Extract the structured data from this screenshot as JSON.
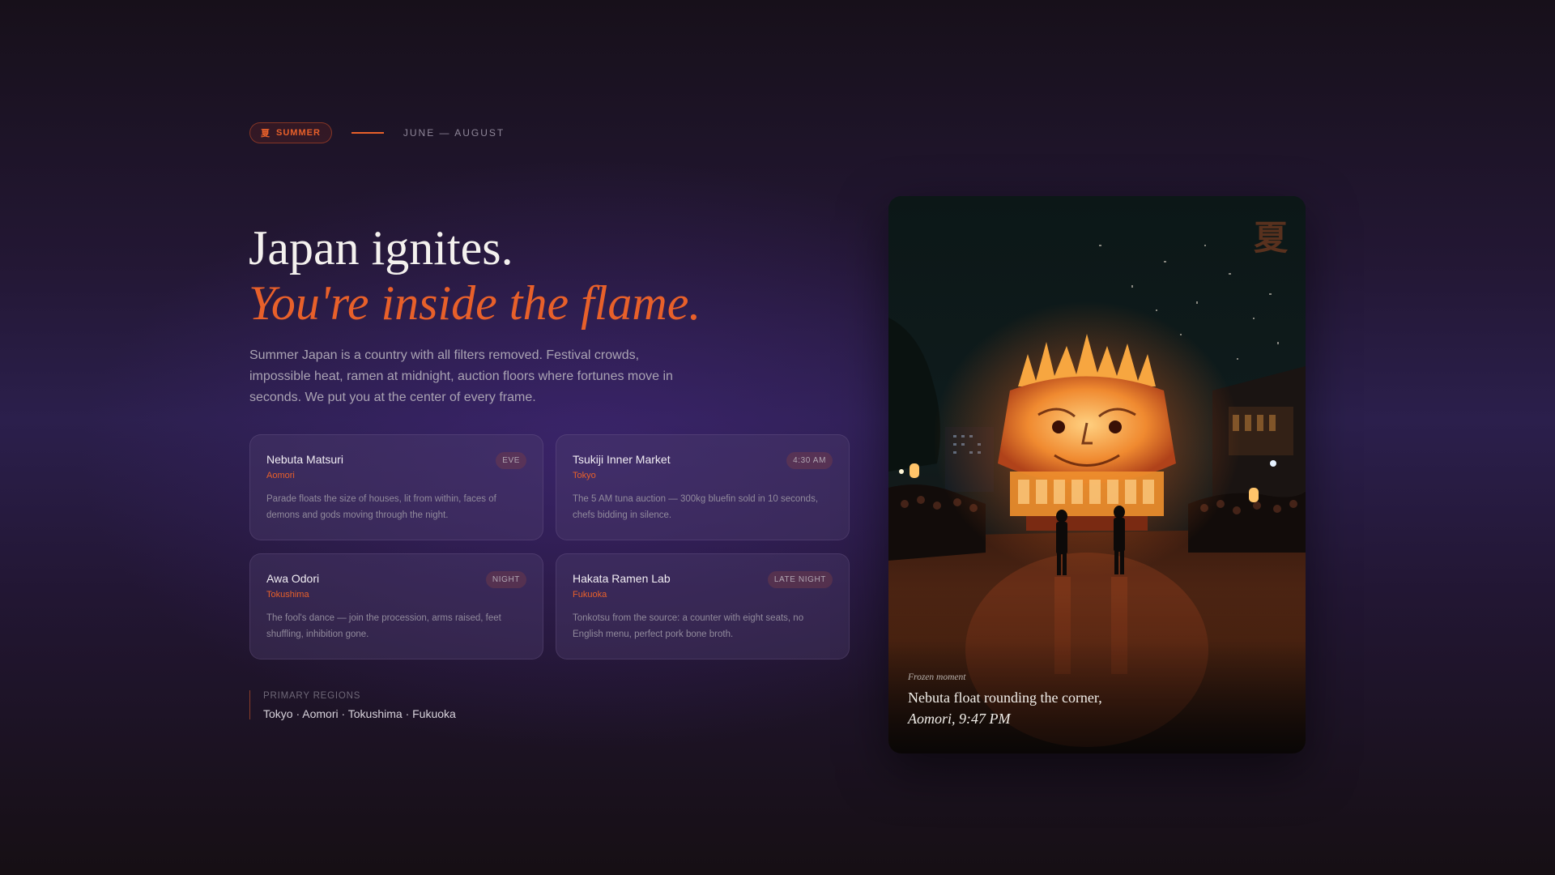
{
  "header": {
    "season_icon": "夏",
    "season_label": "SUMMER",
    "season_range": "JUNE — AUGUST"
  },
  "hero": {
    "title_line1": "Japan ignites.",
    "title_line2": "You're inside the flame.",
    "intro": "Summer Japan is a country with all filters removed. Festival crowds, impossible heat, ramen at midnight, auction floors where fortunes move in seconds. We put you at the center of every frame."
  },
  "cards": [
    {
      "title": "Nebuta Matsuri",
      "location": "Aomori",
      "tag": "EVE",
      "description": "Parade floats the size of houses, lit from within, faces of demons and gods moving through the night."
    },
    {
      "title": "Tsukiji Inner Market",
      "location": "Tokyo",
      "tag": "4:30 AM",
      "description": "The 5 AM tuna auction — 300kg bluefin sold in 10 seconds, chefs bidding in silence."
    },
    {
      "title": "Awa Odori",
      "location": "Tokushima",
      "tag": "NIGHT",
      "description": "The fool's dance — join the procession, arms raised, feet shuffling, inhibition gone."
    },
    {
      "title": "Hakata Ramen Lab",
      "location": "Fukuoka",
      "tag": "LATE NIGHT",
      "description": "Tonkotsu from the source: a counter with eight seats, no English menu, perfect pork bone broth."
    }
  ],
  "regions": {
    "label": "PRIMARY REGIONS",
    "list": "Tokyo · Aomori · Tokushima · Fukuoka"
  },
  "photo": {
    "kanji": "夏",
    "caption_label": "Frozen moment",
    "caption_line1": "Nebuta float rounding the corner,",
    "caption_line2": "Aomori, 9:47 PM"
  },
  "colors": {
    "accent": "#e8602a",
    "background_dark": "#17101a",
    "background_purple": "#2b1f4c"
  }
}
